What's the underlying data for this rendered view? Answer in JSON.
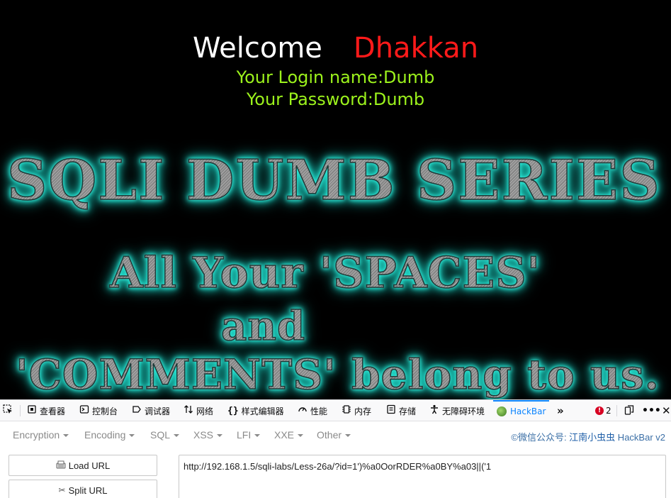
{
  "webpage": {
    "welcome_word": "Welcome",
    "welcome_name": "Dhakkan",
    "login_name_line": "Your Login name:Dumb",
    "password_line": "Your Password:Dumb",
    "banner_title": "SQLI DUMB SERIES",
    "banner_line1": "All Your 'SPACES'",
    "banner_line2": "and",
    "banner_line3": "'COMMENTS' belong to us.",
    "colors": {
      "background": "#000000",
      "welcome": "#ffffff",
      "name": "#ff1a1a",
      "credentials": "#9cf21c",
      "glow": "#2ff5e4"
    }
  },
  "devtools": {
    "tabs": [
      {
        "icon": "inspector-icon",
        "label": "查看器"
      },
      {
        "icon": "console-icon",
        "label": "控制台"
      },
      {
        "icon": "debugger-icon",
        "label": "调试器"
      },
      {
        "icon": "network-icon",
        "label": "网络"
      },
      {
        "icon": "style-editor-icon",
        "label": "样式编辑器"
      },
      {
        "icon": "performance-icon",
        "label": "性能"
      },
      {
        "icon": "memory-icon",
        "label": "内存"
      },
      {
        "icon": "storage-icon",
        "label": "存储"
      },
      {
        "icon": "accessibility-icon",
        "label": "无障碍环境"
      },
      {
        "icon": "hackbar-icon",
        "label": "HackBar"
      }
    ],
    "selected_tab": "HackBar",
    "error_count": "2",
    "accent_color": "#0a84ff"
  },
  "hackbar": {
    "menus": [
      "Encryption",
      "Encoding",
      "SQL",
      "XSS",
      "LFI",
      "XXE",
      "Other"
    ],
    "credit_prefix": "©微信公众号: ",
    "credit_name": "江南小虫虫",
    "credit_version": " HackBar v2",
    "load_url_label": "Load URL",
    "split_url_label": "Split URL",
    "url_value": "http://192.168.1.5/sqli-labs/Less-26a/?id=1')%a0OorRDER%a0BY%a03||('1"
  }
}
